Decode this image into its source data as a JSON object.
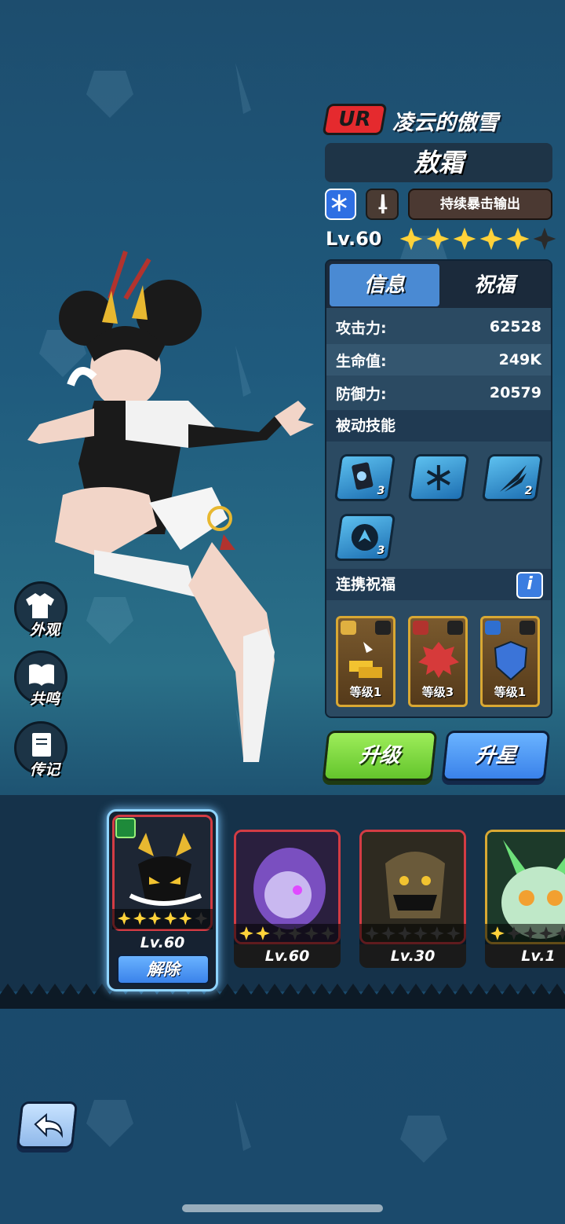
{
  "hero": {
    "rarity": "UR",
    "title": "凌云的傲雪",
    "name": "敖霜",
    "role": "持续暴击输出",
    "level": "Lv.60",
    "stars_filled": 5,
    "stars_total": 6
  },
  "tabs": {
    "info": "信息",
    "blessing": "祝福"
  },
  "stats": [
    {
      "label": "攻击力:",
      "value": "62528"
    },
    {
      "label": "生命值:",
      "value": "249K"
    },
    {
      "label": "防御力:",
      "value": "20579"
    }
  ],
  "passive": {
    "title": "被动技能",
    "skills": [
      {
        "icon": "ice-card-icon",
        "level": "3"
      },
      {
        "icon": "snowflake-burst-icon",
        "level": ""
      },
      {
        "icon": "triple-slash-icon",
        "level": "2"
      },
      {
        "icon": "dragon-emblem-icon",
        "level": "3"
      }
    ]
  },
  "combo": {
    "title": "连携祝福",
    "info": "i",
    "cards": [
      {
        "icon": "gold-bars-icon",
        "label": "等级1"
      },
      {
        "icon": "red-demon-icon",
        "label": "等级3"
      },
      {
        "icon": "blue-shield-icon",
        "label": "等级1"
      }
    ]
  },
  "buttons": {
    "upgrade": "升级",
    "star_up": "升星",
    "unequip": "解除"
  },
  "side_menu": [
    {
      "icon": "shirt-icon",
      "label": "外观"
    },
    {
      "icon": "book-icon",
      "label": "共鸣"
    },
    {
      "icon": "journal-icon",
      "label": "传记"
    }
  ],
  "pets": [
    {
      "name": "antler-beast",
      "level": "Lv.60",
      "stars": 5,
      "selected": true
    },
    {
      "name": "purple-ghost",
      "level": "Lv.60",
      "stars": 2,
      "selected": false
    },
    {
      "name": "fanged-mask",
      "level": "Lv.30",
      "stars": 0,
      "selected": false
    },
    {
      "name": "green-owl",
      "level": "Lv.1",
      "stars": 1,
      "selected": false
    }
  ],
  "colors": {
    "accent_blue": "#4a8ad3",
    "upgrade_green": "#7fd63f",
    "rarity_red": "#e52a2e",
    "star_gold": "#ffd23a"
  }
}
